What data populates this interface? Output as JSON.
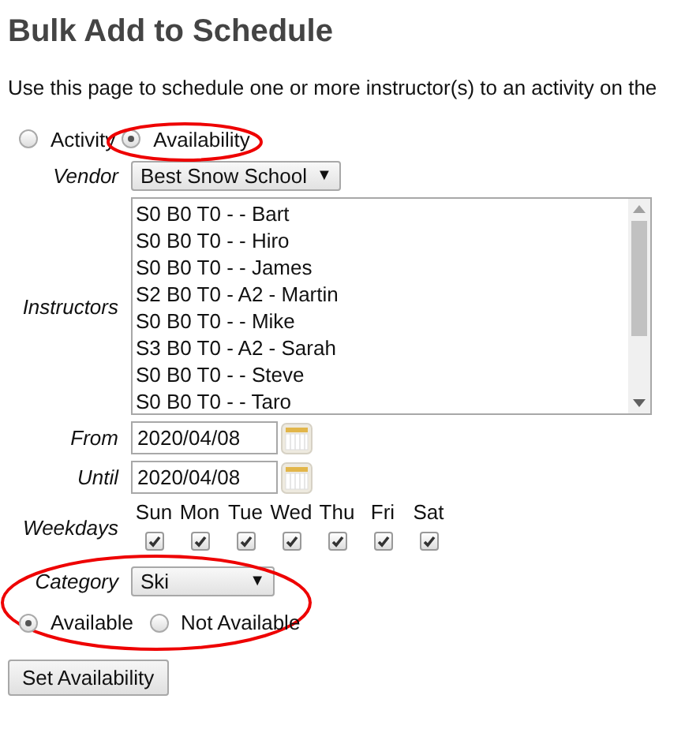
{
  "title": "Bulk Add to Schedule",
  "description": "Use this page to schedule one or more instructor(s) to an activity on the",
  "mode": [
    {
      "label": "Activity",
      "selected": false,
      "circled": false
    },
    {
      "label": "Availability",
      "selected": true,
      "circled": true
    }
  ],
  "vendor": {
    "label": "Vendor",
    "value": "Best Snow School",
    "arrow": "▼"
  },
  "instructors": {
    "label": "Instructors",
    "items": [
      "S0 B0 T0 - - Bart",
      "S0 B0 T0 - - Hiro",
      "S0 B0 T0 - - James",
      "S2 B0 T0 - A2 - Martin",
      "S0 B0 T0 - - Mike",
      "S3 B0 T0 - A2 - Sarah",
      "S0 B0 T0 - - Steve",
      "S0 B0 T0 - - Taro"
    ]
  },
  "from": {
    "label": "From",
    "value": "2020/04/08"
  },
  "until": {
    "label": "Until",
    "value": "2020/04/08"
  },
  "weekdays": {
    "label": "Weekdays",
    "days": [
      {
        "label": "Sun",
        "checked": true
      },
      {
        "label": "Mon",
        "checked": true
      },
      {
        "label": "Tue",
        "checked": true
      },
      {
        "label": "Wed",
        "checked": true
      },
      {
        "label": "Thu",
        "checked": true
      },
      {
        "label": "Fri",
        "checked": true
      },
      {
        "label": "Sat",
        "checked": true
      }
    ]
  },
  "category": {
    "label": "Category",
    "value": "Ski",
    "arrow": "▼",
    "circled": true
  },
  "availability": [
    {
      "label": "Available",
      "selected": true
    },
    {
      "label": "Not Available",
      "selected": false
    }
  ],
  "submit": "Set Availability"
}
